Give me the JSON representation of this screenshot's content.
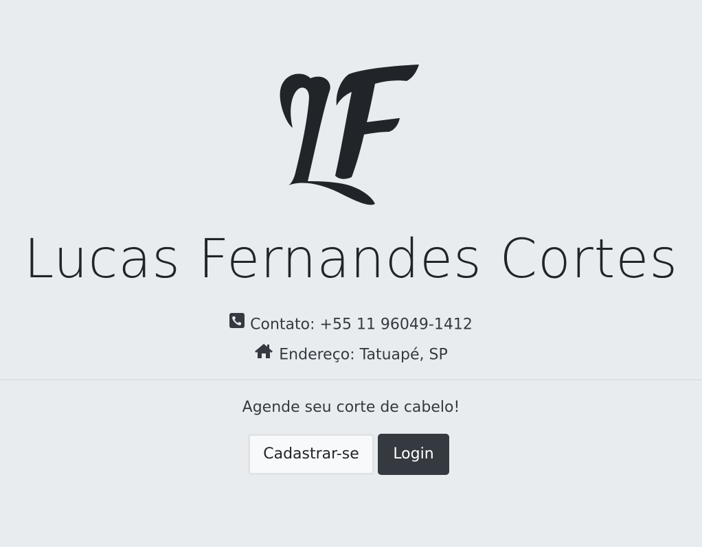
{
  "logo": {
    "text": "LF",
    "icon": "lf-monogram-logo"
  },
  "header": {
    "title": "Lucas Fernandes Cortes"
  },
  "contact": {
    "icon": "phone-square-icon",
    "text": "Contato: +55 11 96049-1412"
  },
  "address": {
    "icon": "home-icon",
    "text": "Endereço: Tatuapé, SP"
  },
  "cta": {
    "text": "Agende seu corte de cabelo!"
  },
  "buttons": {
    "register_label": "Cadastrar-se",
    "login_label": "Login"
  },
  "colors": {
    "background": "#e9ecef",
    "dark_button": "#343a40",
    "light_button": "#f8f9fa",
    "text": "#343a40"
  }
}
